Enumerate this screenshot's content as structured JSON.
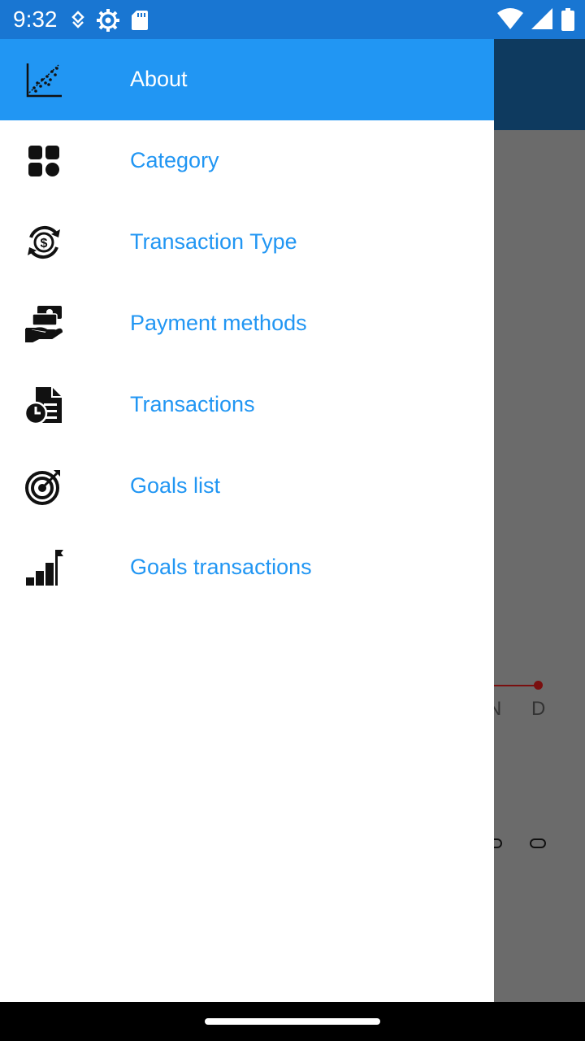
{
  "status_bar": {
    "time": "9:32",
    "left_icons": [
      "data-saver-icon",
      "settings-icon",
      "sd-card-icon"
    ],
    "right_icons": [
      "wifi-icon",
      "signal-icon",
      "battery-icon"
    ]
  },
  "background": {
    "axis_labels": [
      "N",
      "D"
    ]
  },
  "drawer": {
    "header": {
      "label": "About",
      "icon": "scatter-chart-icon"
    },
    "items": [
      {
        "label": "Category",
        "icon": "grid-icon"
      },
      {
        "label": "Transaction Type",
        "icon": "dollar-cycle-icon"
      },
      {
        "label": "Payment methods",
        "icon": "cash-hand-icon"
      },
      {
        "label": "Transactions",
        "icon": "document-clock-icon"
      },
      {
        "label": "Goals list",
        "icon": "target-icon"
      },
      {
        "label": "Goals transactions",
        "icon": "bar-chart-flag-icon"
      }
    ]
  },
  "colors": {
    "status_bar": "#1976d2",
    "drawer_header": "#2196f3",
    "menu_text": "#2196f3",
    "scrim": "#6b6b6b"
  }
}
